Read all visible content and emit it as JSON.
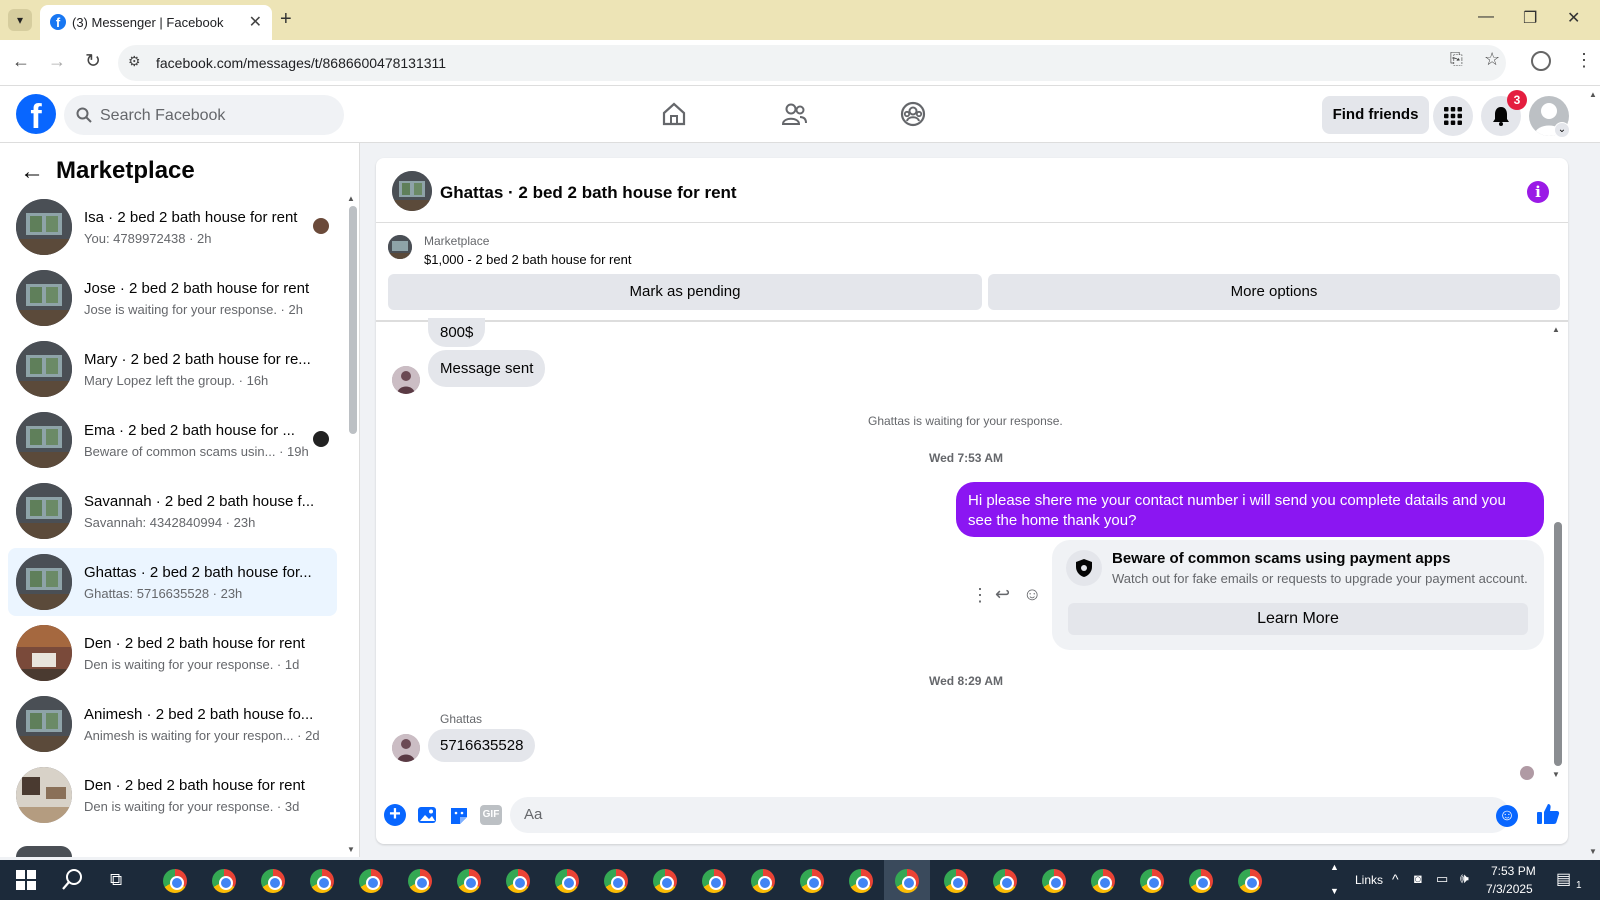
{
  "browser": {
    "tab_title": "(3) Messenger | Facebook",
    "url": "facebook.com/messages/t/8686600478131311"
  },
  "fb": {
    "search_placeholder": "Search Facebook",
    "find_friends": "Find friends",
    "notification_count": "3"
  },
  "sidebar": {
    "title": "Marketplace",
    "conversations": [
      {
        "title": "Isa · 2 bed 2 bath house for rent",
        "preview": "You: 4789972438 · 2h"
      },
      {
        "title": "Jose · 2 bed 2 bath house for rent",
        "preview": "Jose is waiting for your response. · 2h"
      },
      {
        "title": "Mary · 2 bed 2 bath house for re...",
        "preview": "Mary Lopez left the group. · 16h"
      },
      {
        "title": "Ema · 2 bed 2 bath house for ...",
        "preview": "Beware of common scams usin... · 19h"
      },
      {
        "title": "Savannah · 2 bed 2 bath house f...",
        "preview": "Savannah: 4342840994 · 23h"
      },
      {
        "title": "Ghattas · 2 bed 2 bath house for...",
        "preview": "Ghattas: 5716635528 · 23h"
      },
      {
        "title": "Den · 2 bed 2 bath house for rent",
        "preview": "Den is waiting for your response. · 1d"
      },
      {
        "title": "Animesh · 2 bed 2 bath house fo...",
        "preview": "Animesh is waiting for your respon... · 2d"
      },
      {
        "title": "Den · 2 bed 2 bath house for rent",
        "preview": "Den is waiting for your response. · 3d"
      }
    ]
  },
  "chat": {
    "title": "Ghattas · 2 bed 2 bath house for rent",
    "marketplace_label": "Marketplace",
    "listing": "$1,000 - 2 bed 2 bath house for rent",
    "mark_pending": "Mark as pending",
    "more_options": "More options",
    "msg_800": "800$",
    "msg_sent": "Message sent",
    "waiting_note": "Ghattas is waiting for your response.",
    "time1": "Wed 7:53 AM",
    "outgoing": "Hi please shere me your contact number i will send you complete datails and you see the home thank you?",
    "scam_title": "Beware of common scams using payment apps",
    "scam_body": "Watch out for fake emails or requests to upgrade your payment account.",
    "learn_more": "Learn More",
    "time2": "Wed 8:29 AM",
    "sender": "Ghattas",
    "incoming": "5716635528",
    "composer_placeholder": "Aa"
  },
  "taskbar": {
    "links": "Links",
    "time": "7:53 PM",
    "date": "7/3/2025",
    "notif": "1"
  },
  "colors": {
    "accent": "#8b16f2",
    "fb_blue": "#0866ff",
    "taskbar": "#1c2a3a"
  }
}
